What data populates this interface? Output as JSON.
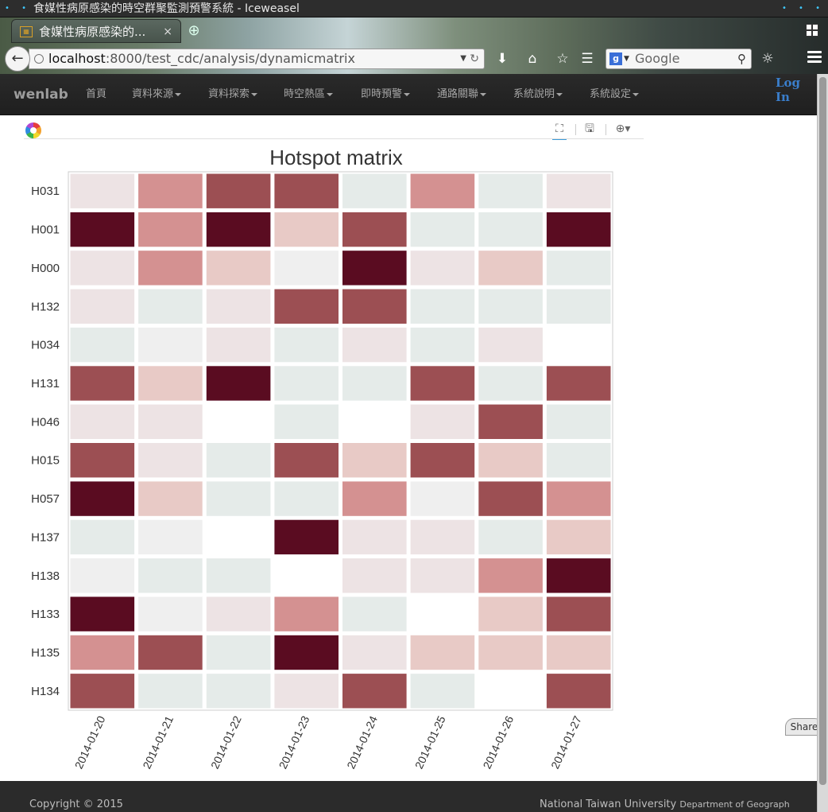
{
  "window": {
    "title": "食媒性病原感染的時空群聚監測預警系統 - Iceweasel"
  },
  "browser": {
    "tab_title": "食媒性病原感染的...",
    "url_host": "localhost",
    "url_path": ":8000/test_cdc/analysis/dynamicmatrix",
    "search_placeholder": "Google"
  },
  "site": {
    "brand": "wenlab",
    "nav": [
      "首頁",
      "資料來源",
      "資料探索",
      "時空熱區",
      "即時預警",
      "通路關聯",
      "系統說明",
      "系統設定"
    ],
    "login": "Log In"
  },
  "chart_data": {
    "type": "heatmap",
    "title": "Hotspot matrix",
    "rows": [
      "H031",
      "H001",
      "H000",
      "H132",
      "H034",
      "H131",
      "H046",
      "H015",
      "H057",
      "H137",
      "H138",
      "H133",
      "H135",
      "H134"
    ],
    "columns": [
      "2014-01-20",
      "2014-01-21",
      "2014-01-22",
      "2014-01-23",
      "2014-01-24",
      "2014-01-25",
      "2014-01-26",
      "2014-01-27"
    ],
    "levels": {
      "0": "#ffffff",
      "1": "#e5ebe9",
      "2": "#efefef",
      "3": "#ede3e4",
      "4": "#e8cac6",
      "5": "#d49191",
      "6": "#9c4f53",
      "7": "#5a0c21"
    },
    "values": [
      [
        3,
        5,
        6,
        6,
        1,
        5,
        1,
        3
      ],
      [
        7,
        5,
        7,
        4,
        6,
        1,
        1,
        7
      ],
      [
        3,
        5,
        4,
        2,
        7,
        3,
        4,
        1
      ],
      [
        3,
        1,
        3,
        6,
        6,
        1,
        1,
        1
      ],
      [
        1,
        2,
        3,
        1,
        3,
        1,
        3,
        0
      ],
      [
        6,
        4,
        7,
        1,
        1,
        6,
        1,
        6
      ],
      [
        3,
        3,
        0,
        1,
        0,
        3,
        6,
        1
      ],
      [
        6,
        3,
        1,
        6,
        4,
        6,
        4,
        1
      ],
      [
        7,
        4,
        1,
        1,
        5,
        2,
        6,
        5
      ],
      [
        1,
        2,
        0,
        7,
        3,
        3,
        1,
        4
      ],
      [
        2,
        1,
        1,
        0,
        3,
        3,
        5,
        7
      ],
      [
        7,
        2,
        3,
        5,
        1,
        0,
        4,
        6
      ],
      [
        5,
        6,
        1,
        7,
        3,
        4,
        4,
        4
      ],
      [
        6,
        1,
        1,
        3,
        6,
        1,
        0,
        6
      ]
    ]
  },
  "footer": {
    "copyright": "Copyright © 2015",
    "org": "National Taiwan University",
    "dept": "Department of Geograph",
    "share": "Share"
  }
}
